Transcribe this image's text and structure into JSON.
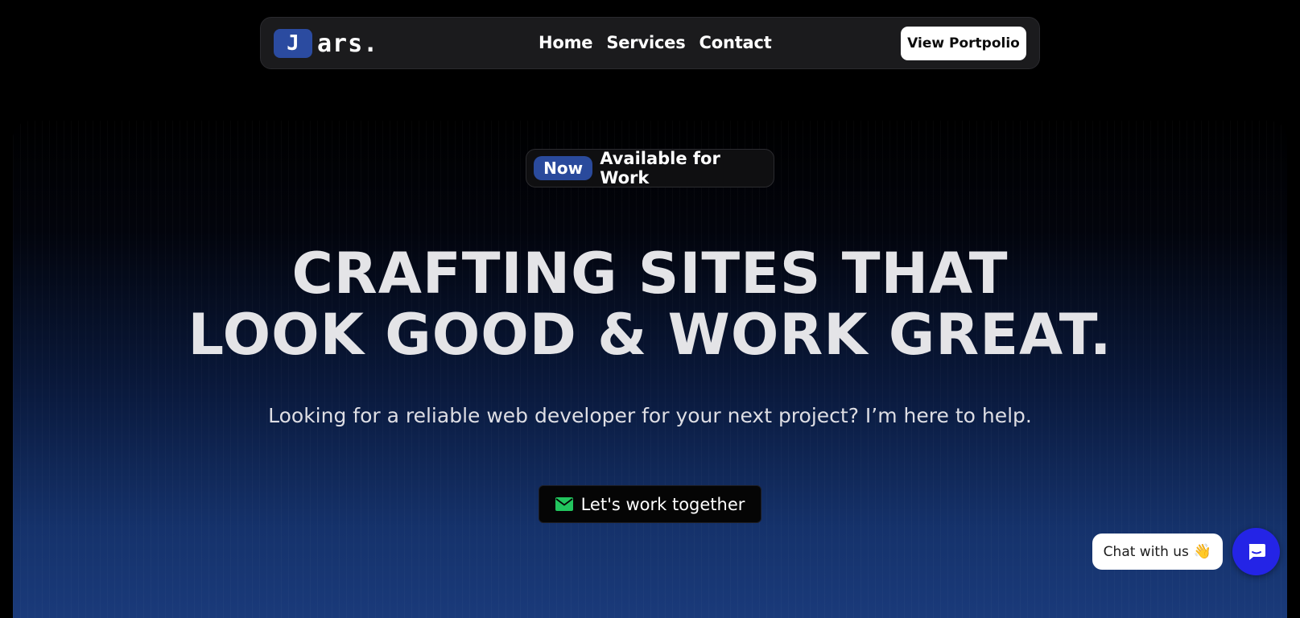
{
  "nav": {
    "logo_letter": "J",
    "logo_text": "ars.",
    "links": [
      {
        "label": "Home"
      },
      {
        "label": "Services"
      },
      {
        "label": "Contact"
      }
    ],
    "portfolio_button": "View Portpolio"
  },
  "hero": {
    "badge_pill": "Now",
    "badge_text": "Available for Work",
    "headline_line1": "CRAFTING SITES THAT",
    "headline_line2": "LOOK GOOD & WORK GREAT.",
    "subtitle": "Looking for a reliable web developer for your next project? I’m here to help.",
    "cta_label": "Let's work together",
    "cta_icon": "envelope-icon"
  },
  "chat": {
    "bubble_text": "Chat with us",
    "bubble_icon": "waving-hand-icon",
    "fab_icon": "chat-icon"
  },
  "colors": {
    "accent_blue": "#2b4ba0",
    "chat_fab": "#2424e6",
    "mail_icon_green": "#22c55e",
    "headline": "#e4e4e7"
  }
}
